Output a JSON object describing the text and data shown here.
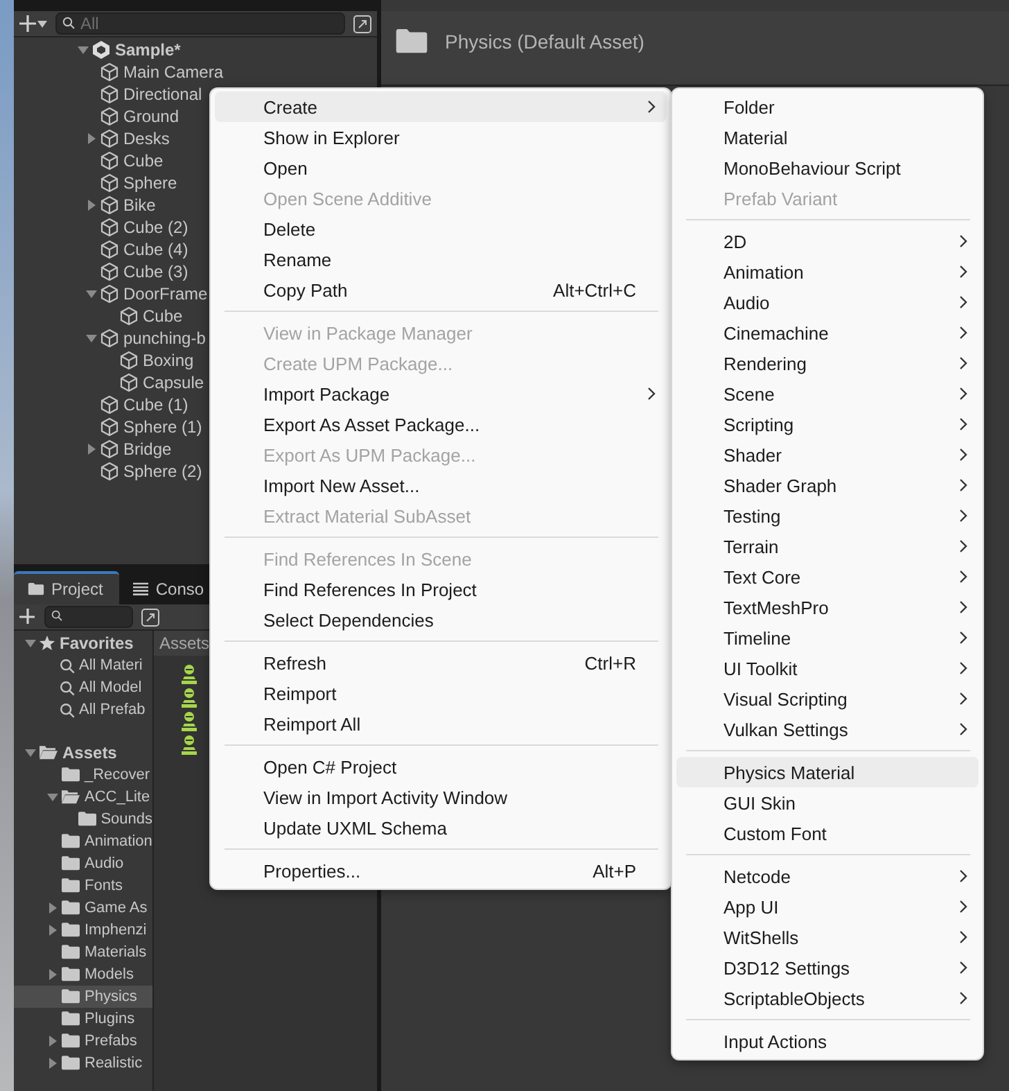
{
  "hierarchy": {
    "search": {
      "placeholder": "All"
    },
    "scene": {
      "label": "Sample*",
      "expanded": true,
      "children": [
        {
          "label": "Main Camera",
          "expandable": false,
          "expanded": false
        },
        {
          "label": "Directional",
          "expandable": false,
          "expanded": false
        },
        {
          "label": "Ground",
          "expandable": false,
          "expanded": false
        },
        {
          "label": "Desks",
          "expandable": true,
          "expanded": false
        },
        {
          "label": "Cube",
          "expandable": false,
          "expanded": false
        },
        {
          "label": "Sphere",
          "expandable": false,
          "expanded": false
        },
        {
          "label": "Bike",
          "expandable": true,
          "expanded": false
        },
        {
          "label": "Cube (2)",
          "expandable": false,
          "expanded": false
        },
        {
          "label": "Cube (4)",
          "expandable": false,
          "expanded": false
        },
        {
          "label": "Cube (3)",
          "expandable": false,
          "expanded": false
        },
        {
          "label": "DoorFrame",
          "expandable": true,
          "expanded": true,
          "children": [
            {
              "label": "Cube",
              "expandable": false,
              "expanded": false
            }
          ]
        },
        {
          "label": "punching-b",
          "expandable": true,
          "expanded": true,
          "children": [
            {
              "label": "Boxing",
              "expandable": false,
              "expanded": false
            },
            {
              "label": "Capsule",
              "expandable": false,
              "expanded": false
            }
          ]
        },
        {
          "label": "Cube (1)",
          "expandable": false,
          "expanded": false
        },
        {
          "label": "Sphere (1)",
          "expandable": false,
          "expanded": false
        },
        {
          "label": "Bridge",
          "expandable": true,
          "expanded": false
        },
        {
          "label": "Sphere (2)",
          "expandable": false,
          "expanded": false
        }
      ]
    }
  },
  "project": {
    "tabs": [
      {
        "label": "Project",
        "selected": true
      },
      {
        "label": "Conso",
        "selected": false
      }
    ],
    "favorites": {
      "label": "Favorites",
      "expanded": true,
      "items": [
        {
          "label": "All Materi"
        },
        {
          "label": "All Model"
        },
        {
          "label": "All Prefab"
        }
      ]
    },
    "assets": {
      "label": "Assets",
      "expanded": true,
      "children": [
        {
          "label": "_Recover",
          "expandable": false,
          "expanded": false,
          "selected": false
        },
        {
          "label": "ACC_Lite",
          "expandable": true,
          "expanded": true,
          "selected": false,
          "children": [
            {
              "label": "Sounds",
              "expandable": false,
              "expanded": false,
              "selected": false
            }
          ]
        },
        {
          "label": "Animation",
          "expandable": false,
          "expanded": false,
          "selected": false
        },
        {
          "label": "Audio",
          "expandable": false,
          "expanded": false,
          "selected": false
        },
        {
          "label": "Fonts",
          "expandable": false,
          "expanded": false,
          "selected": false
        },
        {
          "label": "Game As",
          "expandable": true,
          "expanded": false,
          "selected": false
        },
        {
          "label": "Imphenzi",
          "expandable": true,
          "expanded": false,
          "selected": false
        },
        {
          "label": "Materials",
          "expandable": false,
          "expanded": false,
          "selected": false
        },
        {
          "label": "Models",
          "expandable": true,
          "expanded": false,
          "selected": false
        },
        {
          "label": "Physics",
          "expandable": false,
          "expanded": false,
          "selected": true
        },
        {
          "label": "Plugins",
          "expandable": false,
          "expanded": false,
          "selected": false
        },
        {
          "label": "Prefabs",
          "expandable": true,
          "expanded": false,
          "selected": false
        },
        {
          "label": "Realistic",
          "expandable": true,
          "expanded": false,
          "selected": false
        }
      ]
    },
    "breadcrumb": "Assets",
    "asset_icons": [
      {
        "kind": "physics-material"
      },
      {
        "kind": "physics-material"
      },
      {
        "kind": "physics-material"
      },
      {
        "kind": "physics-material"
      }
    ]
  },
  "inspector": {
    "title": "Physics (Default Asset)"
  },
  "context_menu": {
    "groups": [
      [
        {
          "label": "Create",
          "submenu": true,
          "disabled": false,
          "selected": true
        },
        {
          "label": "Show in Explorer",
          "submenu": false,
          "disabled": false,
          "selected": false
        },
        {
          "label": "Open",
          "submenu": false,
          "disabled": false,
          "selected": false
        },
        {
          "label": "Open Scene Additive",
          "submenu": false,
          "disabled": true,
          "selected": false
        },
        {
          "label": "Delete",
          "submenu": false,
          "disabled": false,
          "selected": false
        },
        {
          "label": "Rename",
          "submenu": false,
          "disabled": false,
          "selected": false
        },
        {
          "label": "Copy Path",
          "shortcut": "Alt+Ctrl+C",
          "submenu": false,
          "disabled": false,
          "selected": false
        }
      ],
      [
        {
          "label": "View in Package Manager",
          "submenu": false,
          "disabled": true,
          "selected": false
        },
        {
          "label": "Create UPM Package...",
          "submenu": false,
          "disabled": true,
          "selected": false
        },
        {
          "label": "Import Package",
          "submenu": true,
          "disabled": false,
          "selected": false
        },
        {
          "label": "Export As Asset Package...",
          "submenu": false,
          "disabled": false,
          "selected": false
        },
        {
          "label": "Export As UPM Package...",
          "submenu": false,
          "disabled": true,
          "selected": false
        },
        {
          "label": "Import New Asset...",
          "submenu": false,
          "disabled": false,
          "selected": false
        },
        {
          "label": "Extract Material SubAsset",
          "submenu": false,
          "disabled": true,
          "selected": false
        }
      ],
      [
        {
          "label": "Find References In Scene",
          "submenu": false,
          "disabled": true,
          "selected": false
        },
        {
          "label": "Find References In Project",
          "submenu": false,
          "disabled": false,
          "selected": false
        },
        {
          "label": "Select Dependencies",
          "submenu": false,
          "disabled": false,
          "selected": false
        }
      ],
      [
        {
          "label": "Refresh",
          "shortcut": "Ctrl+R",
          "submenu": false,
          "disabled": false,
          "selected": false
        },
        {
          "label": "Reimport",
          "submenu": false,
          "disabled": false,
          "selected": false
        },
        {
          "label": "Reimport All",
          "submenu": false,
          "disabled": false,
          "selected": false
        }
      ],
      [
        {
          "label": "Open C# Project",
          "submenu": false,
          "disabled": false,
          "selected": false
        },
        {
          "label": "View in Import Activity Window",
          "submenu": false,
          "disabled": false,
          "selected": false
        },
        {
          "label": "Update UXML Schema",
          "submenu": false,
          "disabled": false,
          "selected": false
        }
      ],
      [
        {
          "label": "Properties...",
          "shortcut": "Alt+P",
          "submenu": false,
          "disabled": false,
          "selected": false
        }
      ]
    ]
  },
  "create_submenu": {
    "groups": [
      [
        {
          "label": "Folder",
          "submenu": false,
          "disabled": false,
          "selected": false
        },
        {
          "label": "Material",
          "submenu": false,
          "disabled": false,
          "selected": false
        },
        {
          "label": "MonoBehaviour Script",
          "submenu": false,
          "disabled": false,
          "selected": false
        },
        {
          "label": "Prefab Variant",
          "submenu": false,
          "disabled": true,
          "selected": false
        }
      ],
      [
        {
          "label": "2D",
          "submenu": true,
          "disabled": false,
          "selected": false
        },
        {
          "label": "Animation",
          "submenu": true,
          "disabled": false,
          "selected": false
        },
        {
          "label": "Audio",
          "submenu": true,
          "disabled": false,
          "selected": false
        },
        {
          "label": "Cinemachine",
          "submenu": true,
          "disabled": false,
          "selected": false
        },
        {
          "label": "Rendering",
          "submenu": true,
          "disabled": false,
          "selected": false
        },
        {
          "label": "Scene",
          "submenu": true,
          "disabled": false,
          "selected": false
        },
        {
          "label": "Scripting",
          "submenu": true,
          "disabled": false,
          "selected": false
        },
        {
          "label": "Shader",
          "submenu": true,
          "disabled": false,
          "selected": false
        },
        {
          "label": "Shader Graph",
          "submenu": true,
          "disabled": false,
          "selected": false
        },
        {
          "label": "Testing",
          "submenu": true,
          "disabled": false,
          "selected": false
        },
        {
          "label": "Terrain",
          "submenu": true,
          "disabled": false,
          "selected": false
        },
        {
          "label": "Text Core",
          "submenu": true,
          "disabled": false,
          "selected": false
        },
        {
          "label": "TextMeshPro",
          "submenu": true,
          "disabled": false,
          "selected": false
        },
        {
          "label": "Timeline",
          "submenu": true,
          "disabled": false,
          "selected": false
        },
        {
          "label": "UI Toolkit",
          "submenu": true,
          "disabled": false,
          "selected": false
        },
        {
          "label": "Visual Scripting",
          "submenu": true,
          "disabled": false,
          "selected": false
        },
        {
          "label": "Vulkan Settings",
          "submenu": true,
          "disabled": false,
          "selected": false
        }
      ],
      [
        {
          "label": "Physics Material",
          "submenu": false,
          "disabled": false,
          "selected": true
        },
        {
          "label": "GUI Skin",
          "submenu": false,
          "disabled": false,
          "selected": false
        },
        {
          "label": "Custom Font",
          "submenu": false,
          "disabled": false,
          "selected": false
        }
      ],
      [
        {
          "label": "Netcode",
          "submenu": true,
          "disabled": false,
          "selected": false
        },
        {
          "label": "App UI",
          "submenu": true,
          "disabled": false,
          "selected": false
        },
        {
          "label": "WitShells",
          "submenu": true,
          "disabled": false,
          "selected": false
        },
        {
          "label": "D3D12 Settings",
          "submenu": true,
          "disabled": false,
          "selected": false
        },
        {
          "label": "ScriptableObjects",
          "submenu": true,
          "disabled": false,
          "selected": false
        }
      ],
      [
        {
          "label": "Input Actions",
          "submenu": false,
          "disabled": false,
          "selected": false
        }
      ]
    ]
  }
}
